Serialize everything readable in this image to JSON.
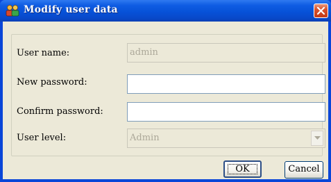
{
  "window": {
    "title": "Modify user data",
    "app_icon": "users-icon",
    "close_icon": "close-icon"
  },
  "form": {
    "username": {
      "label": "User name:",
      "value": "admin",
      "enabled": false
    },
    "new_password": {
      "label": "New password:",
      "value": "",
      "enabled": true
    },
    "confirm_password": {
      "label": "Confirm password:",
      "value": "",
      "enabled": true
    },
    "user_level": {
      "label": "User level:",
      "value": "Admin",
      "enabled": false,
      "icon": "chevron-down-icon"
    }
  },
  "buttons": {
    "ok_label": "OK",
    "cancel_label": "Cancel"
  },
  "colors": {
    "titlebar": "#0752d8",
    "client_bg": "#ece9d8",
    "close_button": "#d9502b"
  }
}
